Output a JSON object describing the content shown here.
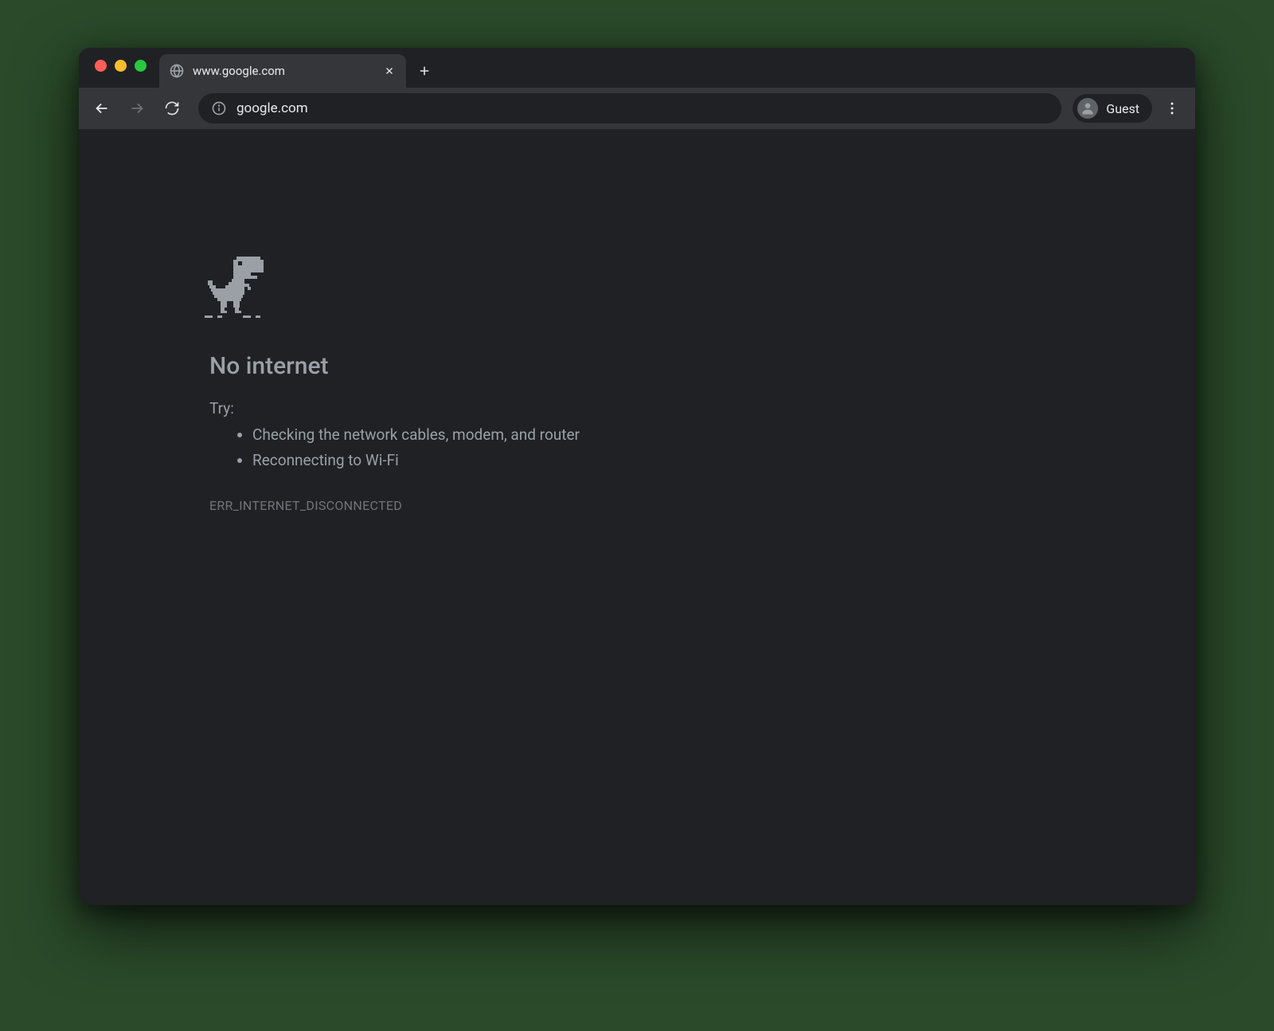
{
  "tab": {
    "title": "www.google.com"
  },
  "toolbar": {
    "url": "google.com",
    "profile_label": "Guest"
  },
  "error": {
    "title": "No internet",
    "try_label": "Try:",
    "suggestions": [
      "Checking the network cables, modem, and router",
      "Reconnecting to Wi-Fi"
    ],
    "code": "ERR_INTERNET_DISCONNECTED"
  }
}
